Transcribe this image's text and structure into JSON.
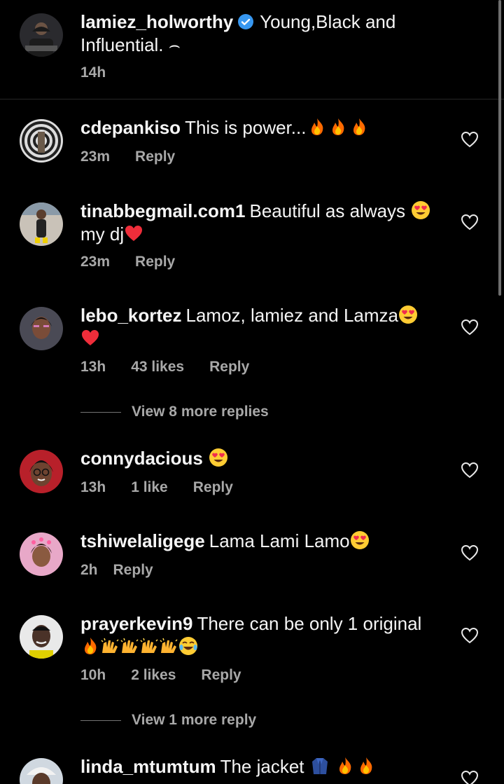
{
  "caption": {
    "username": "lamiez_holworthy",
    "text": "Young,Black and Influential. ⌢",
    "time": "14h"
  },
  "comments": [
    {
      "username": "cdepankiso",
      "text": "This is power...",
      "time": "23m",
      "likes": "",
      "reply": "Reply"
    },
    {
      "username": "tinabbegmail.com1",
      "text": "Beautiful as always",
      "text2": "my dj",
      "time": "23m",
      "likes": "",
      "reply": "Reply"
    },
    {
      "username": "lebo_kortez",
      "text": "Lamoz, lamiez and Lamza",
      "time": "13h",
      "likes": "43 likes",
      "reply": "Reply"
    },
    {
      "username": "connydacious",
      "text": "",
      "time": "13h",
      "likes": "1 like",
      "reply": "Reply"
    },
    {
      "username": "tshiwelaligege",
      "text": "Lama Lami Lamo",
      "time": "2h",
      "likes": "",
      "reply": "Reply"
    },
    {
      "username": "prayerkevin9",
      "text": "There can be only 1 original",
      "time": "10h",
      "likes": "2 likes",
      "reply": "Reply"
    },
    {
      "username": "linda_mtumtum",
      "text": "The jacket",
      "time": "",
      "likes": "",
      "reply": ""
    }
  ],
  "view_more": [
    "View 8 more replies",
    "View 1 more reply"
  ],
  "colors": {
    "background": "#000000",
    "muted": "#a8a8a8",
    "verified": "#3797f0",
    "heart_red": "#ff3040"
  }
}
